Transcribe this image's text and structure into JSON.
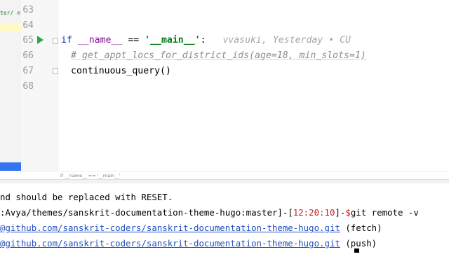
{
  "left_panel": {
    "fragment_text": "ter/ ⊘"
  },
  "editor": {
    "lines": [
      {
        "number": "63"
      },
      {
        "number": "64"
      },
      {
        "number": "65",
        "kw_if": "if",
        "dunder_name": "__name__",
        "op": "==",
        "main_str": "'__main__'",
        "colon": ":",
        "blame": "vvasuki, Yesterday • CU"
      },
      {
        "number": "66",
        "comment": "# get_appt_locs_for_district_ids(age=18, min_slots=1)"
      },
      {
        "number": "67",
        "call": "continuous_query()"
      },
      {
        "number": "68"
      }
    ],
    "breadcrumb": "if __name__ == '__main__'"
  },
  "terminal": {
    "line1": "nd should be replaced with RESET.",
    "line2_prefix": ":Avya/themes/sanskrit-documentation-theme-hugo:master]-[",
    "line2_time": "12:20:10",
    "line2_mid": "]-",
    "line2_dollar": "$",
    "line2_cmd": "git remote -v",
    "line3_link": "@github.com/sanskrit-coders/sanskrit-documentation-theme-hugo.git",
    "line3_suffix": " (fetch)",
    "line4_link": "@github.com/sanskrit-coders/sanskrit-documentation-theme-hugo.git",
    "line4_suffix": " (push)"
  },
  "colors": {
    "keyword": "#0033b3",
    "string": "#067d17",
    "comment": "#8c8c8c",
    "prompt_red": "#c7222a",
    "link": "#2150c2",
    "run_green": "#2fa44f"
  },
  "icons": [
    "run-gutter-icon",
    "fold-icon"
  ]
}
